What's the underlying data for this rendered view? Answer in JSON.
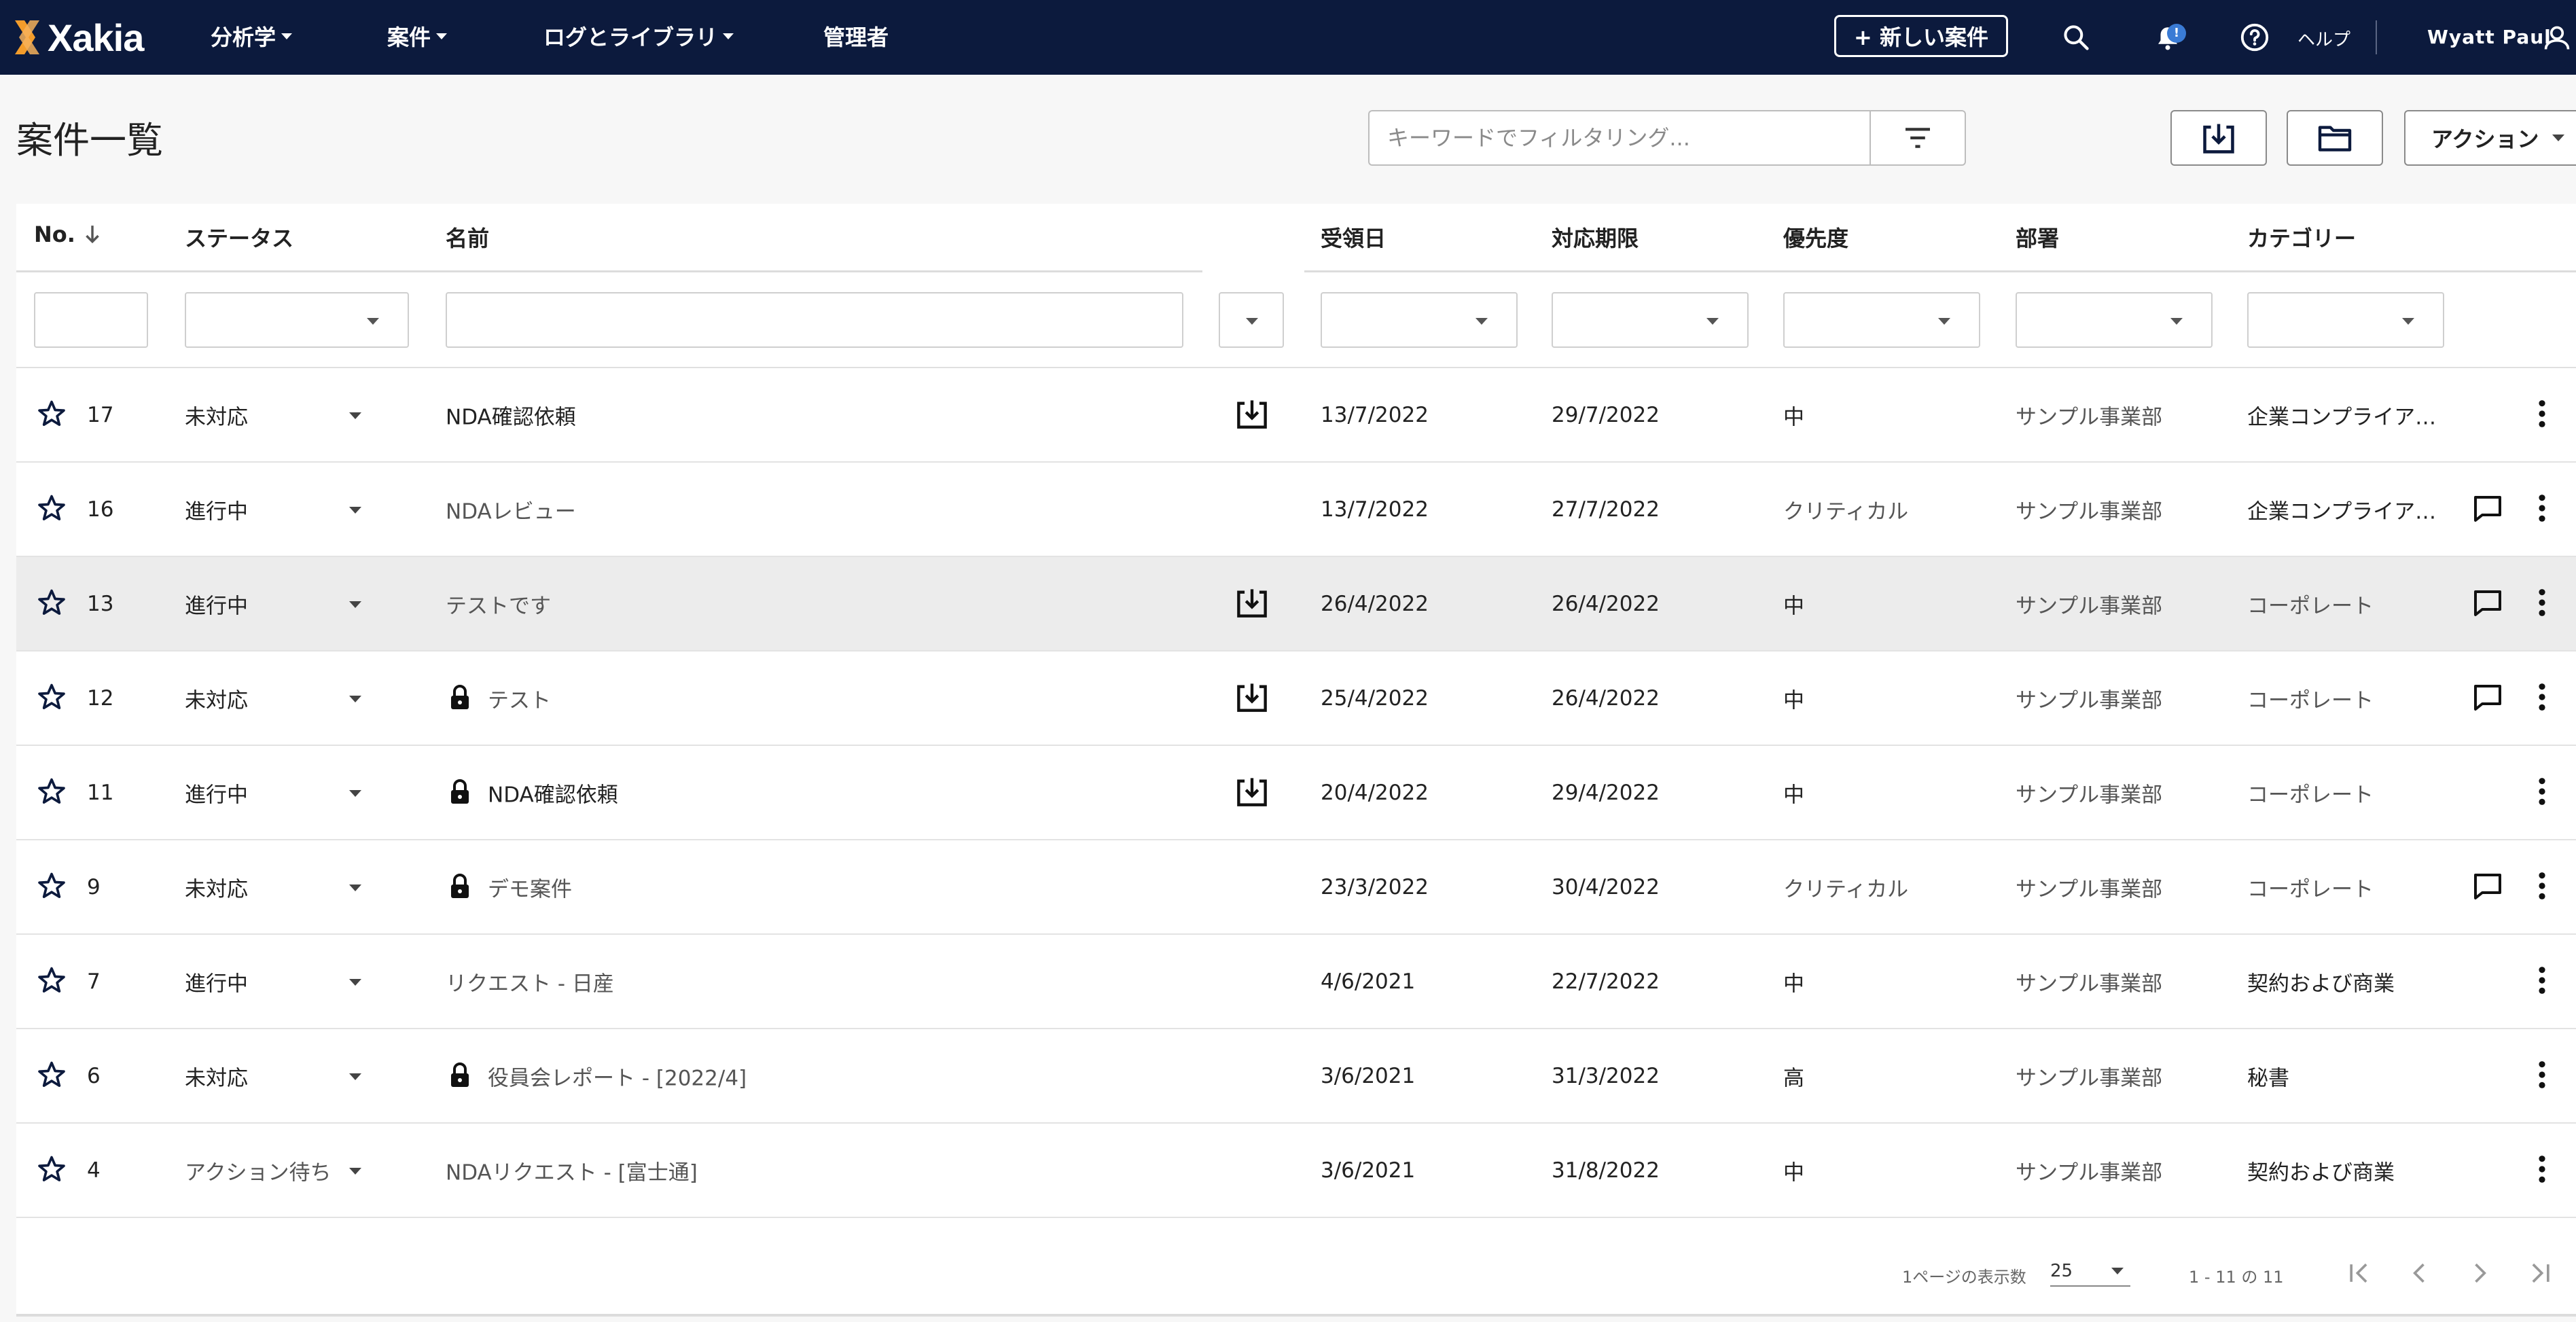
{
  "app": {
    "brand": "Xakia"
  },
  "nav": {
    "items": [
      {
        "label": "分析学"
      },
      {
        "label": "案件"
      },
      {
        "label": "ログとライブラリ"
      },
      {
        "label": "管理者"
      }
    ],
    "new_case_label": "+ 新しい案件",
    "notification_badge": "!",
    "help_label": "ヘルプ",
    "user_name": "Wyatt Paul"
  },
  "page": {
    "title": "案件一覧",
    "filter_placeholder": "キーワードでフィルタリング...",
    "action_label": "アクション"
  },
  "table": {
    "headers": {
      "no": "No.",
      "status": "ステータス",
      "name": "名前",
      "received": "受領日",
      "due": "対応期限",
      "priority": "優先度",
      "department": "部署",
      "category": "カテゴリー"
    },
    "rows": [
      {
        "no": "17",
        "status": "未対応",
        "name": "NDA確認依頼",
        "received": "13/7/2022",
        "due": "29/7/2022",
        "priority": "中",
        "department": "サンプル事業部",
        "category": "企業コンプライア…"
      },
      {
        "no": "16",
        "status": "進行中",
        "name": "NDAレビュー",
        "received": "13/7/2022",
        "due": "27/7/2022",
        "priority": "クリティカル",
        "department": "サンプル事業部",
        "category": "企業コンプライア…"
      },
      {
        "no": "13",
        "status": "進行中",
        "name": "テストです",
        "received": "26/4/2022",
        "due": "26/4/2022",
        "priority": "中",
        "department": "サンプル事業部",
        "category": "コーポレート"
      },
      {
        "no": "12",
        "status": "未対応",
        "name": "テスト",
        "received": "25/4/2022",
        "due": "26/4/2022",
        "priority": "中",
        "department": "サンプル事業部",
        "category": "コーポレート"
      },
      {
        "no": "11",
        "status": "進行中",
        "name": "NDA確認依頼",
        "received": "20/4/2022",
        "due": "29/4/2022",
        "priority": "中",
        "department": "サンプル事業部",
        "category": "コーポレート"
      },
      {
        "no": "9",
        "status": "未対応",
        "name": "デモ案件",
        "received": "23/3/2022",
        "due": "30/4/2022",
        "priority": "クリティカル",
        "department": "サンプル事業部",
        "category": "コーポレート"
      },
      {
        "no": "7",
        "status": "進行中",
        "name": "リクエスト - 日産",
        "received": "4/6/2021",
        "due": "22/7/2022",
        "priority": "中",
        "department": "サンプル事業部",
        "category": "契約および商業"
      },
      {
        "no": "6",
        "status": "未対応",
        "name": "役員会レポート - [2022/4]",
        "received": "3/6/2021",
        "due": "31/3/2022",
        "priority": "高",
        "department": "サンプル事業部",
        "category": "秘書"
      },
      {
        "no": "4",
        "status": "アクション待ち",
        "name": "NDAリクエスト - [富士通]",
        "received": "3/6/2021",
        "due": "31/8/2022",
        "priority": "中",
        "department": "サンプル事業部",
        "category": "契約および商業"
      }
    ]
  },
  "pagination": {
    "per_page_label": "1ページの表示数",
    "per_page_value": "25",
    "range_label": "1 - 11 の 11"
  },
  "colors": {
    "nav_bg": "#0c1a3d",
    "accent_orange": "#f39c2b",
    "badge_blue": "#3a7bd5"
  }
}
